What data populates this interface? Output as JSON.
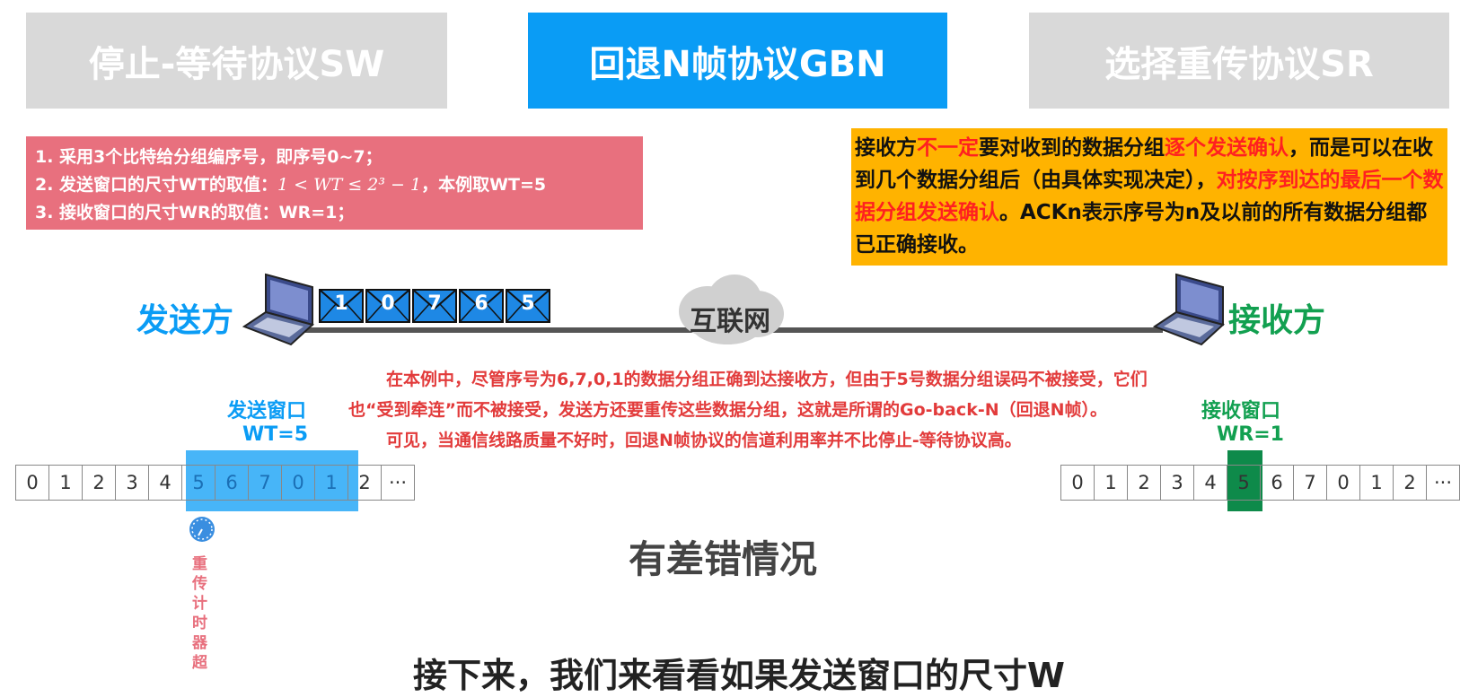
{
  "tabs": [
    {
      "label": "停止-等待协议SW"
    },
    {
      "label": "回退N帧协议GBN"
    },
    {
      "label": "选择重传协议SR"
    }
  ],
  "rules": {
    "line1": "1. 采用3个比特给分组编序号，即序号0~7；",
    "line2_prefix": "2. 发送窗口的尺寸WT的取值：",
    "line2_math": "1 < WT ≤ 2³ − 1",
    "line2_suffix": "，本例取WT=5",
    "line3": "3. 接收窗口的尺寸WR的取值：WR=1；"
  },
  "note": {
    "p1": "接收方",
    "p2": "不一定",
    "p3": "要对收到的数据分组",
    "p4": "逐个发送确认",
    "p5": "，而是可以在收到几个数据分组后（由具体实现决定），",
    "p6": "对按序到达的最后一个数据分组发送确认",
    "p7": "。ACKn表示序号为n及以前的所有数据分组都已正确接收。"
  },
  "sender": {
    "label": "发送方"
  },
  "receiver": {
    "label": "接收方"
  },
  "network": {
    "label": "互联网"
  },
  "in_flight_packets": [
    "1",
    "0",
    "7",
    "6",
    "5"
  ],
  "explanation": {
    "line1": "在本例中，尽管序号为6,7,0,1的数据分组正确到达接收方，但由于5号数据分组误码不被接受，它们",
    "line2": "也“受到牵连”而不被接受，发送方还要重传这些数据分组，这就是所谓的Go-back-N（回退N帧）。",
    "line3": "可见，当通信线路质量不好时，回退N帧协议的信道利用率并不比停止-等待协议高。"
  },
  "send_window": {
    "title": "发送窗口",
    "size": "WT=5",
    "sequence": [
      "0",
      "1",
      "2",
      "3",
      "4",
      "5",
      "6",
      "7",
      "0",
      "1",
      "2",
      "···"
    ]
  },
  "recv_window": {
    "title": "接收窗口",
    "size": "WR=1",
    "sequence": [
      "0",
      "1",
      "2",
      "3",
      "4",
      "5",
      "6",
      "7",
      "0",
      "1",
      "2",
      "···"
    ]
  },
  "timer": {
    "label": "重传计时器超"
  },
  "caption": "有差错情况",
  "subtitle": "接下来，我们来看看如果发送窗口的尺寸W",
  "colors": {
    "accent_blue": "#0a9cf5",
    "tab_gray": "#d9d9d9",
    "rules_red": "#e8707e",
    "note_orange": "#ffb300",
    "recv_green": "#0e8a4a"
  }
}
